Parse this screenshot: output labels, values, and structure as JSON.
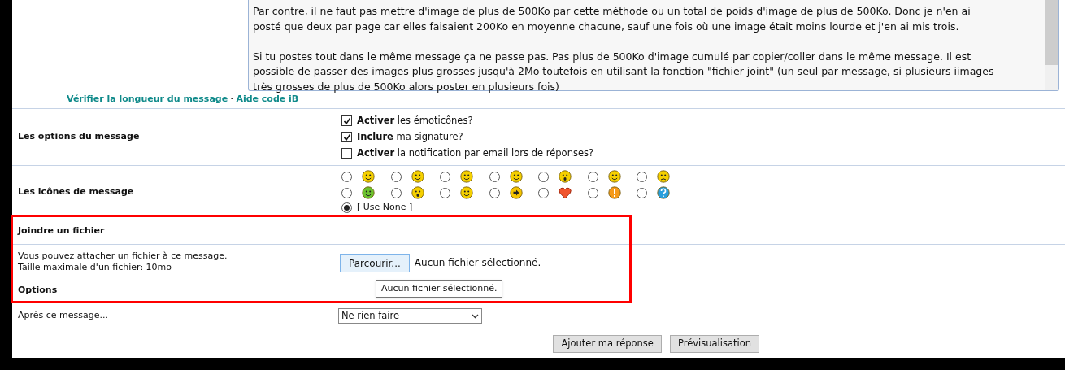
{
  "message_text": {
    "paragraphs": [
      [
        "Par contre, il ne faut pas mettre d'image de plus de 500Ko par cette méthode ou un total de poids d'image de plus de 500Ko. Donc je n'en ai",
        "posté que deux par page car elles faisaient 200Ko en moyenne chacune, sauf une fois où une image était moins lourde et j'en ai mis trois."
      ],
      [
        "Si tu postes tout dans le même message ça ne passe pas. Pas plus de 500Ko d'image cumulé par copier/coller dans le même message. Il est",
        "possible de passer des images plus grosses jusqu'à 2Mo toutefois en utilisant la fonction \"fichier joint\" (un seul par message, si plusieurs iimages",
        "très grosses de plus de 500Ko alors poster en plusieurs fois)"
      ]
    ]
  },
  "links": [
    "Vérifier la longueur du message",
    "Aide code iB"
  ],
  "link_separator": "·",
  "message_options": {
    "label": "Les options du message",
    "items": [
      {
        "bold": "Activer",
        "text": "les émoticônes?",
        "checked": true
      },
      {
        "bold": "Inclure",
        "text": "ma signature?",
        "checked": true
      },
      {
        "bold": "Activer",
        "text": "la notification par email lors de réponses?",
        "checked": false
      }
    ]
  },
  "message_icons": {
    "label": "Les icônes de message",
    "icons": [
      {
        "kind": "smile",
        "color": "#f5d000",
        "selected": false
      },
      {
        "kind": "smirk",
        "color": "#f5d000",
        "selected": false
      },
      {
        "kind": "sleepy",
        "color": "#f5d000",
        "selected": false
      },
      {
        "kind": "happy",
        "color": "#f5d000",
        "selected": false
      },
      {
        "kind": "shock",
        "color": "#f5d000",
        "selected": false
      },
      {
        "kind": "grin",
        "color": "#f5d000",
        "selected": false
      },
      {
        "kind": "angry",
        "color": "#f5d000",
        "selected": false
      },
      {
        "kind": "sick",
        "color": "#6cc22e",
        "selected": false
      },
      {
        "kind": "eek",
        "color": "#f5d000",
        "selected": false
      },
      {
        "kind": "cool",
        "color": "#f5d000",
        "selected": false
      },
      {
        "kind": "arrow",
        "color": "#f5c400",
        "selected": false
      },
      {
        "kind": "heart",
        "color": "#f0552e",
        "selected": false
      },
      {
        "kind": "warning",
        "color": "#f59a1a",
        "selected": false
      },
      {
        "kind": "question",
        "color": "#2a9fdc",
        "selected": false
      }
    ],
    "none": {
      "label": "[ Use None ]",
      "selected": true
    }
  },
  "attach": {
    "heading": "Joindre un fichier",
    "description": [
      "Vous pouvez attacher un fichier à ce message.",
      "Taille maximale d'un fichier: 10mo"
    ],
    "browse_button": "Parcourir...",
    "status": "Aucun fichier sélectionné.",
    "tooltip": "Aucun fichier sélectionné."
  },
  "options": {
    "heading": "Options",
    "after_label": "Après ce message...",
    "after_value": "Ne rien faire"
  },
  "buttons": [
    "Ajouter ma réponse",
    "Prévisualisation"
  ]
}
